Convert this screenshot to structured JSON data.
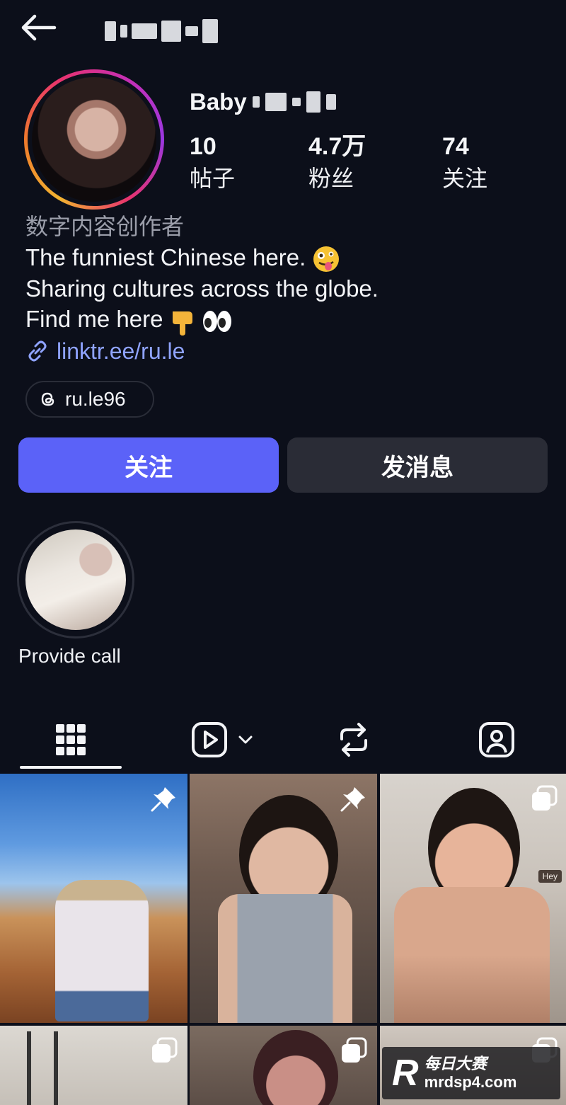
{
  "header": {
    "back_icon": "arrow-left-icon"
  },
  "profile": {
    "name_visible": "Baby",
    "stats": [
      {
        "value": "10",
        "label": "帖子"
      },
      {
        "value": "4.7万",
        "label": "粉丝"
      },
      {
        "value": "74",
        "label": "关注"
      }
    ],
    "category": "数字内容创作者",
    "bio": {
      "line1": "The funniest Chinese here.",
      "line2": "Sharing cultures across the globe.",
      "line3": "Find me here"
    },
    "link": "linktr.ee/ru.le",
    "threads_handle": "ru.le96"
  },
  "actions": {
    "follow_label": "关注",
    "message_label": "发消息"
  },
  "highlights": [
    {
      "label": "Provide call"
    }
  ],
  "tabs": [
    {
      "name": "grid",
      "icon": "grid-icon",
      "active": true
    },
    {
      "name": "reels",
      "icon": "reels-icon"
    },
    {
      "name": "reposts",
      "icon": "repost-icon"
    },
    {
      "name": "tagged",
      "icon": "tagged-person-icon"
    }
  ],
  "posts": [
    {
      "pinned": true,
      "type": "photo"
    },
    {
      "pinned": true,
      "type": "photo"
    },
    {
      "pinned": false,
      "type": "carousel",
      "badge": "Hey"
    },
    {
      "pinned": false,
      "type": "carousel"
    },
    {
      "pinned": false,
      "type": "carousel"
    },
    {
      "pinned": false,
      "type": "carousel"
    }
  ],
  "watermark": {
    "mark": "R",
    "cn": "每日大赛",
    "site": "mrdsp4.com"
  },
  "colors": {
    "background": "#0c0f1a",
    "accent": "#5b62f8",
    "link": "#8fa3ff",
    "secondary_button": "#2a2c36"
  }
}
